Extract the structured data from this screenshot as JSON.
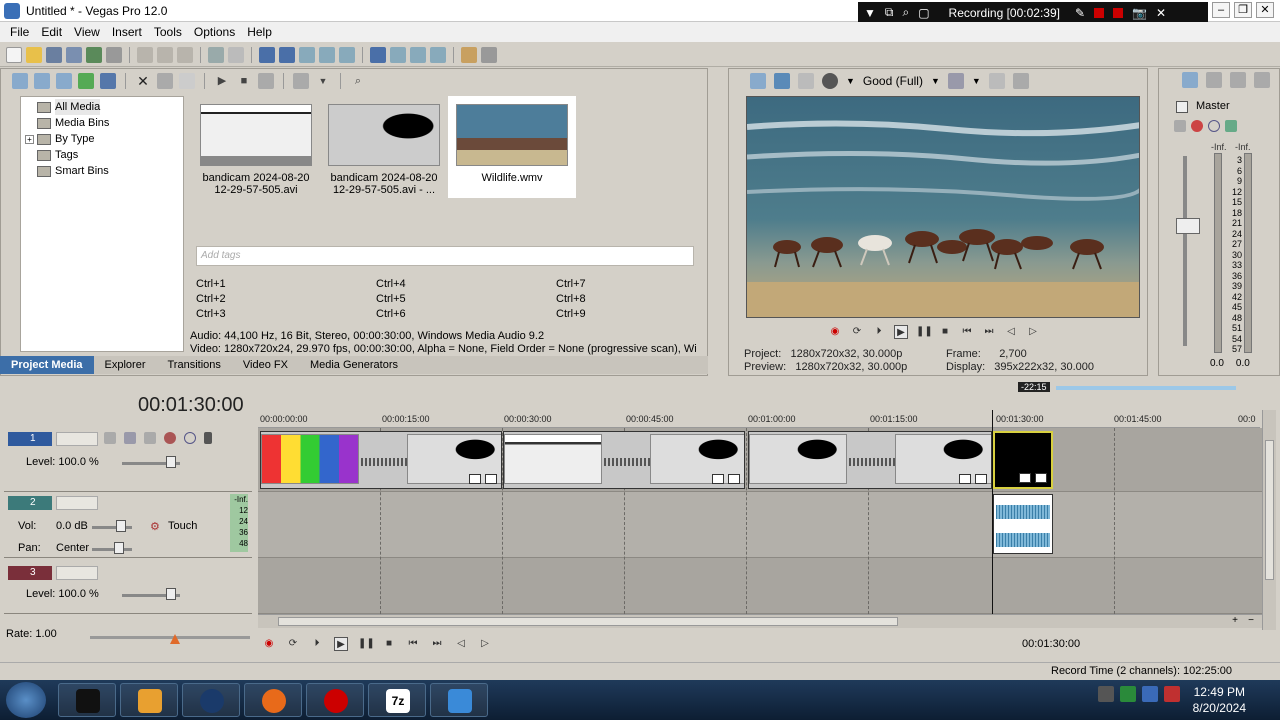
{
  "titlebar": {
    "title": "Untitled * - Vegas Pro 12.0"
  },
  "recorder": {
    "status": "Recording [00:02:39]"
  },
  "menu": [
    "File",
    "Edit",
    "View",
    "Insert",
    "Tools",
    "Options",
    "Help"
  ],
  "media_tree": [
    {
      "label": "All Media",
      "selected": true,
      "expandable": false
    },
    {
      "label": "Media Bins",
      "selected": false,
      "expandable": false
    },
    {
      "label": "By Type",
      "selected": false,
      "expandable": true
    },
    {
      "label": "Tags",
      "selected": false,
      "expandable": false
    },
    {
      "label": "Smart Bins",
      "selected": false,
      "expandable": false
    }
  ],
  "media_items": [
    {
      "caption_1": "bandicam 2024-08-20",
      "caption_2": "12-29-57-505.avi",
      "selected": false
    },
    {
      "caption_1": "bandicam 2024-08-20",
      "caption_2": "12-29-57-505.avi - ...",
      "selected": false
    },
    {
      "caption_1": "Wildlife.wmv",
      "caption_2": "",
      "selected": true
    }
  ],
  "tags": {
    "placeholder": "Add tags"
  },
  "shortcuts": [
    "Ctrl+1",
    "Ctrl+4",
    "Ctrl+7",
    "Ctrl+2",
    "Ctrl+5",
    "Ctrl+8",
    "Ctrl+3",
    "Ctrl+6",
    "Ctrl+9"
  ],
  "media_info": {
    "audio": "Audio: 44,100 Hz, 16 Bit, Stereo, 00:00:30:00, Windows Media Audio 9.2",
    "video": "Video: 1280x720x24, 29.970 fps, 00:00:30:00, Alpha = None, Field Order = None (progressive scan), Wi"
  },
  "bottom_tabs": [
    {
      "label": "Project Media",
      "active": true
    },
    {
      "label": "Explorer",
      "active": false
    },
    {
      "label": "Transitions",
      "active": false
    },
    {
      "label": "Video FX",
      "active": false
    },
    {
      "label": "Media Generators",
      "active": false
    }
  ],
  "preview": {
    "quality": "Good (Full)",
    "project_label": "Project:",
    "project_value": "1280x720x32, 30.000p",
    "preview_label": "Preview:",
    "preview_value": "1280x720x32, 30.000p",
    "frame_label": "Frame:",
    "frame_value": "2,700",
    "display_label": "Display:",
    "display_value": "395x222x32, 30.000"
  },
  "master": {
    "label": "Master",
    "inf_left": "-Inf.",
    "inf_right": "-Inf.",
    "scale": [
      "3",
      "6",
      "9",
      "12",
      "15",
      "18",
      "21",
      "24",
      "27",
      "30",
      "33",
      "36",
      "39",
      "42",
      "45",
      "48",
      "51",
      "54",
      "57"
    ],
    "val_left": "0.0",
    "val_right": "0.0"
  },
  "timeline": {
    "timecode": "00:01:30:00",
    "marker": "-22:15",
    "ruler": [
      "00:00:00:00",
      "00:00:15:00",
      "00:00:30:00",
      "00:00:45:00",
      "00:01:00:00",
      "00:01:15:00",
      "00:01:30:00",
      "00:01:45:00",
      "00:0"
    ]
  },
  "tracks": [
    {
      "number": "1",
      "level": "Level: 100.0 %"
    },
    {
      "number": "2",
      "vol_label": "Vol:",
      "vol": "0.0 dB",
      "pan_label": "Pan:",
      "pan": "Center",
      "mode": "Touch",
      "meter": [
        "-Inf.",
        "12",
        "24",
        "36",
        "48"
      ]
    },
    {
      "number": "3",
      "level": "Level: 100.0 %"
    }
  ],
  "rate": "Rate: 1.00",
  "bottom_time": "00:01:30:00",
  "status": "Record Time (2 channels): 102:25:00",
  "clock": {
    "time": "12:49 PM",
    "date": "8/20/2024"
  },
  "colors": {
    "accent": "#3c6ea8",
    "recording": "#cc0000",
    "taskbar": "#1f3a5a"
  }
}
